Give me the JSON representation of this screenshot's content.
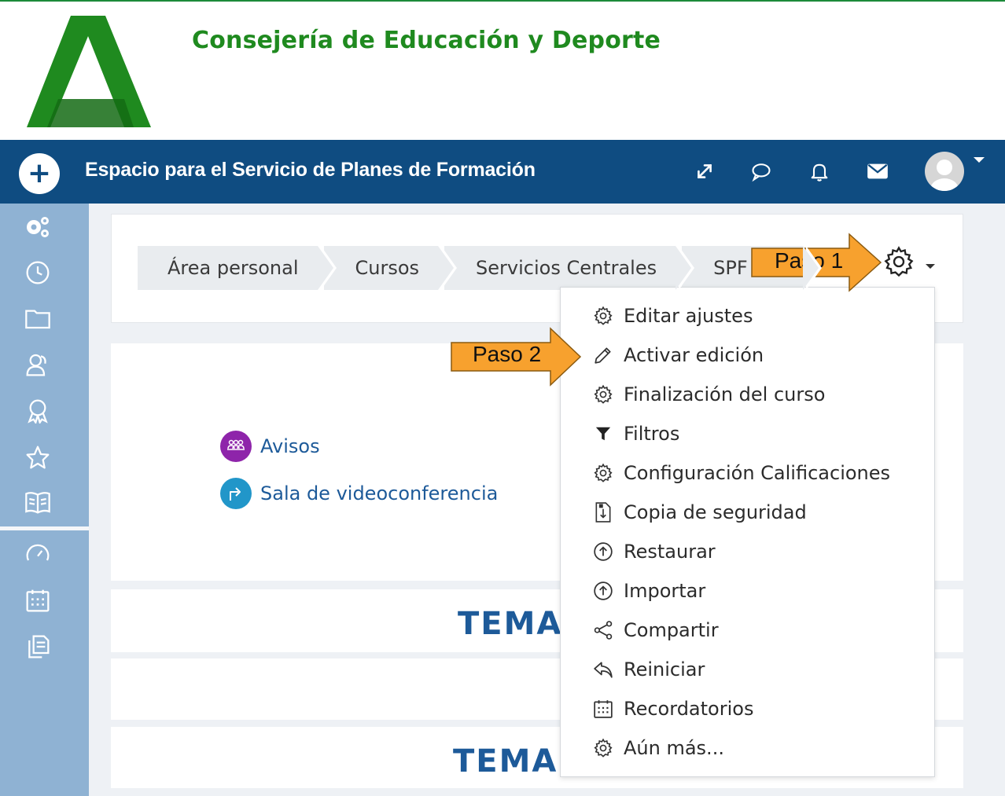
{
  "header": {
    "org_title": "Consejería de Educación y Deporte",
    "logo_name": "junta-andalucia-logo",
    "colors": {
      "logo_green": "#1f8a1f",
      "logo_dark_green": "#146b14"
    }
  },
  "navbar": {
    "site_title": "Espacio para el Servicio de Planes de Formación",
    "plus_label": "+",
    "icons": [
      "expand-icon",
      "chat-icon",
      "bell-icon",
      "envelope-icon",
      "avatar"
    ],
    "colors": {
      "bg": "#0f4c81"
    }
  },
  "sidebar": {
    "icons": [
      "cogs-icon",
      "clock-icon",
      "folder-icon",
      "users-icon",
      "award-icon",
      "star-icon",
      "book-icon",
      "dashboard-icon",
      "calendar-icon",
      "files-icon"
    ],
    "colors": {
      "bg": "#8fb2d3"
    }
  },
  "breadcrumb": {
    "items": [
      "Área personal",
      "Cursos",
      "Servicios Centrales",
      "SPF"
    ]
  },
  "activities": [
    {
      "label": "Avisos",
      "icon": "forum-icon",
      "color": "#8e24aa"
    },
    {
      "label": "Sala de videoconferencia",
      "icon": "url-arrow-icon",
      "color": "#2196c9"
    }
  ],
  "sections": [
    {
      "label": "TEMA"
    },
    {
      "label": "TEMA"
    }
  ],
  "menu": {
    "items": [
      {
        "label": "Editar ajustes",
        "icon": "gear-icon"
      },
      {
        "label": "Activar edición",
        "icon": "pencil-icon"
      },
      {
        "label": "Finalización del curso",
        "icon": "gear-icon"
      },
      {
        "label": "Filtros",
        "icon": "filter-icon"
      },
      {
        "label": "Configuración Calificaciones",
        "icon": "gear-icon"
      },
      {
        "label": "Copia de seguridad",
        "icon": "backup-file-icon"
      },
      {
        "label": "Restaurar",
        "icon": "upload-circle-icon"
      },
      {
        "label": "Importar",
        "icon": "upload-circle-icon"
      },
      {
        "label": "Compartir",
        "icon": "share-icon"
      },
      {
        "label": "Reiniciar",
        "icon": "reply-icon"
      },
      {
        "label": "Recordatorios",
        "icon": "calendar-icon"
      },
      {
        "label": "Aún más...",
        "icon": "gear-icon"
      }
    ]
  },
  "callouts": {
    "step1": "Paso 1",
    "step2": "Paso 2",
    "colors": {
      "fill": "#f7a12e",
      "stroke": "#8a5a10"
    }
  }
}
